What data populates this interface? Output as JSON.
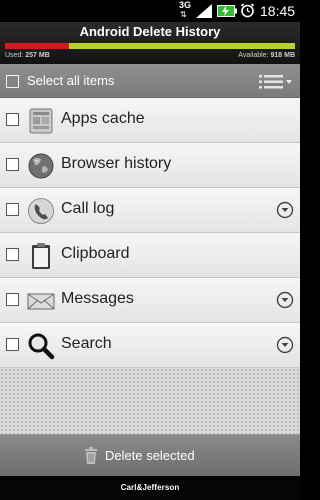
{
  "status_bar": {
    "network": "3G",
    "network_arrows": "⇅",
    "time": "18:45",
    "icons": [
      "signal-icon",
      "battery-charging-icon",
      "alarm-icon"
    ]
  },
  "header": {
    "title": "Android Delete History",
    "used_text": "Used:",
    "used_value": "257 MB",
    "available_text": "Available:",
    "available_value": "918 MB",
    "used_fraction": 0.22,
    "colors": {
      "used": "#d31a1a",
      "available": "#b4d42c"
    }
  },
  "select_all": {
    "label": "Select all items",
    "checked": false,
    "menu_icon": "list-view-icon"
  },
  "items": [
    {
      "label": "Apps cache",
      "icon": "apps-cache-icon",
      "checked": false,
      "expandable": false
    },
    {
      "label": "Browser history",
      "icon": "globe-icon",
      "checked": false,
      "expandable": false
    },
    {
      "label": "Call log",
      "icon": "phone-icon",
      "checked": false,
      "expandable": true
    },
    {
      "label": "Clipboard",
      "icon": "clipboard-icon",
      "checked": false,
      "expandable": false
    },
    {
      "label": "Messages",
      "icon": "envelope-icon",
      "checked": false,
      "expandable": true
    },
    {
      "label": "Search",
      "icon": "magnifier-icon",
      "checked": false,
      "expandable": true
    }
  ],
  "footer": {
    "delete_label": "Delete selected",
    "brand": "Carl&Jefferson"
  }
}
